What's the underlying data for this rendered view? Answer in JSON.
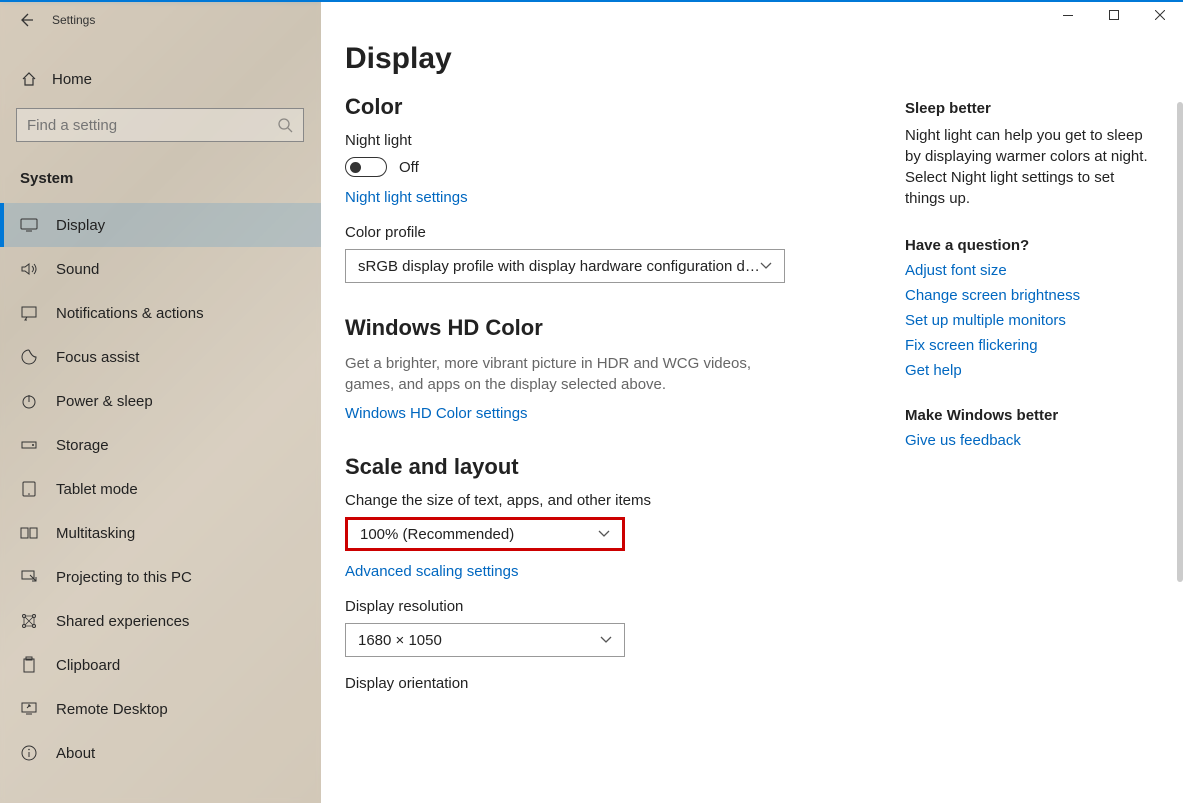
{
  "window": {
    "title": "Settings"
  },
  "sidebar": {
    "home": "Home",
    "search_placeholder": "Find a setting",
    "section": "System",
    "items": [
      {
        "label": "Display",
        "icon": "display-icon",
        "active": true
      },
      {
        "label": "Sound",
        "icon": "sound-icon"
      },
      {
        "label": "Notifications & actions",
        "icon": "notifications-icon"
      },
      {
        "label": "Focus assist",
        "icon": "focus-assist-icon"
      },
      {
        "label": "Power & sleep",
        "icon": "power-icon"
      },
      {
        "label": "Storage",
        "icon": "storage-icon"
      },
      {
        "label": "Tablet mode",
        "icon": "tablet-icon"
      },
      {
        "label": "Multitasking",
        "icon": "multitasking-icon"
      },
      {
        "label": "Projecting to this PC",
        "icon": "projecting-icon"
      },
      {
        "label": "Shared experiences",
        "icon": "shared-icon"
      },
      {
        "label": "Clipboard",
        "icon": "clipboard-icon"
      },
      {
        "label": "Remote Desktop",
        "icon": "remote-desktop-icon"
      },
      {
        "label": "About",
        "icon": "about-icon"
      }
    ]
  },
  "main": {
    "title": "Display",
    "color": {
      "heading": "Color",
      "night_light_label": "Night light",
      "night_light_state": "Off",
      "night_light_link": "Night light settings",
      "color_profile_label": "Color profile",
      "color_profile_value": "sRGB display profile with display hardware configuration d…"
    },
    "hd": {
      "heading": "Windows HD Color",
      "desc": "Get a brighter, more vibrant picture in HDR and WCG videos, games, and apps on the display selected above.",
      "link": "Windows HD Color settings"
    },
    "scale": {
      "heading": "Scale and layout",
      "change_size_label": "Change the size of text, apps, and other items",
      "change_size_value": "100% (Recommended)",
      "advanced_link": "Advanced scaling settings",
      "resolution_label": "Display resolution",
      "resolution_value": "1680 × 1050",
      "orientation_label": "Display orientation"
    }
  },
  "aside": {
    "sleep": {
      "heading": "Sleep better",
      "body": "Night light can help you get to sleep by displaying warmer colors at night. Select Night light settings to set things up."
    },
    "question": {
      "heading": "Have a question?",
      "links": [
        "Adjust font size",
        "Change screen brightness",
        "Set up multiple monitors",
        "Fix screen flickering",
        "Get help"
      ]
    },
    "feedback": {
      "heading": "Make Windows better",
      "link": "Give us feedback"
    }
  }
}
